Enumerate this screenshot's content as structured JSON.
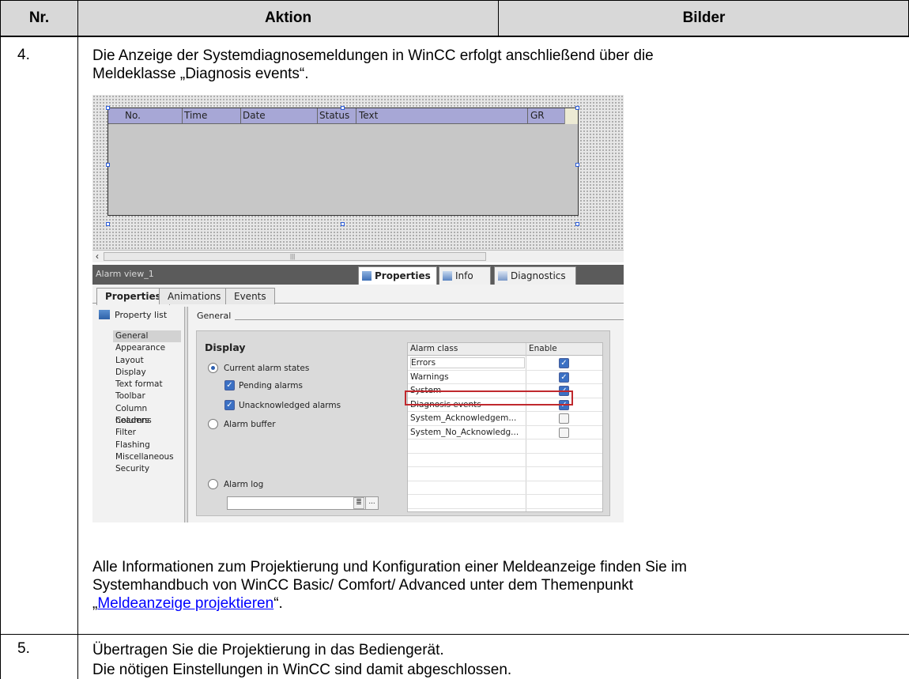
{
  "table": {
    "headers": {
      "nr": "Nr.",
      "aktion": "Aktion",
      "bilder": "Bilder"
    },
    "rows": [
      {
        "nr": "4.",
        "intro_line1": "Die Anzeige der Systemdiagnosemeldungen in WinCC erfolgt anschließend über die",
        "intro_line2": "Meldeklasse „Diagnosis events“.",
        "info_line1": "Alle Informationen zum Projektierung und Konfiguration einer Meldeanzeige finden Sie im",
        "info_line2": "Systemhandbuch von WinCC Basic/ Comfort/ Advanced unter dem Themenpunkt",
        "info_quote_open": "„",
        "info_link": "Meldeanzeige projektieren",
        "info_quote_close": "“."
      },
      {
        "nr": "5.",
        "line1": "Übertragen Sie die Projektierung in das Bediengerät.",
        "line2": "Die nötigen Einstellungen in WinCC sind damit abgeschlossen."
      }
    ]
  },
  "screenshot": {
    "alarm_view_columns": [
      "No.",
      "Time",
      "Date",
      "Status",
      "Text",
      "GR"
    ],
    "panel_title": "Alarm view_1",
    "panel_tabs": [
      "Properties",
      "Info",
      "Diagnostics"
    ],
    "sub_tabs": [
      "Properties",
      "Animations",
      "Events"
    ],
    "property_list_label": "Property list",
    "nav_items": [
      "General",
      "Appearance",
      "Layout",
      "Display",
      "Text format",
      "Toolbar",
      "Column headers",
      "Columns",
      "Filter",
      "Flashing",
      "Miscellaneous",
      "Security"
    ],
    "section_title": "General",
    "group_title": "Display",
    "options": {
      "current_alarm_states": "Current alarm states",
      "pending_alarms": "Pending alarms",
      "unacknowledged_alarms": "Unacknowledged alarms",
      "alarm_buffer": "Alarm buffer",
      "alarm_log": "Alarm log"
    },
    "log_button": "...",
    "alarm_class_table": {
      "headers": [
        "Alarm class",
        "Enable"
      ],
      "rows": [
        {
          "name": "Errors",
          "enabled": true
        },
        {
          "name": "Warnings",
          "enabled": true
        },
        {
          "name": "System",
          "enabled": true
        },
        {
          "name": "Diagnosis events",
          "enabled": true
        },
        {
          "name": "System_Acknowledgem...",
          "enabled": false
        },
        {
          "name": "System_No_Acknowledg...",
          "enabled": false
        }
      ]
    },
    "highlight_color": "#c0282d",
    "header_color": "#a7a7d6"
  }
}
